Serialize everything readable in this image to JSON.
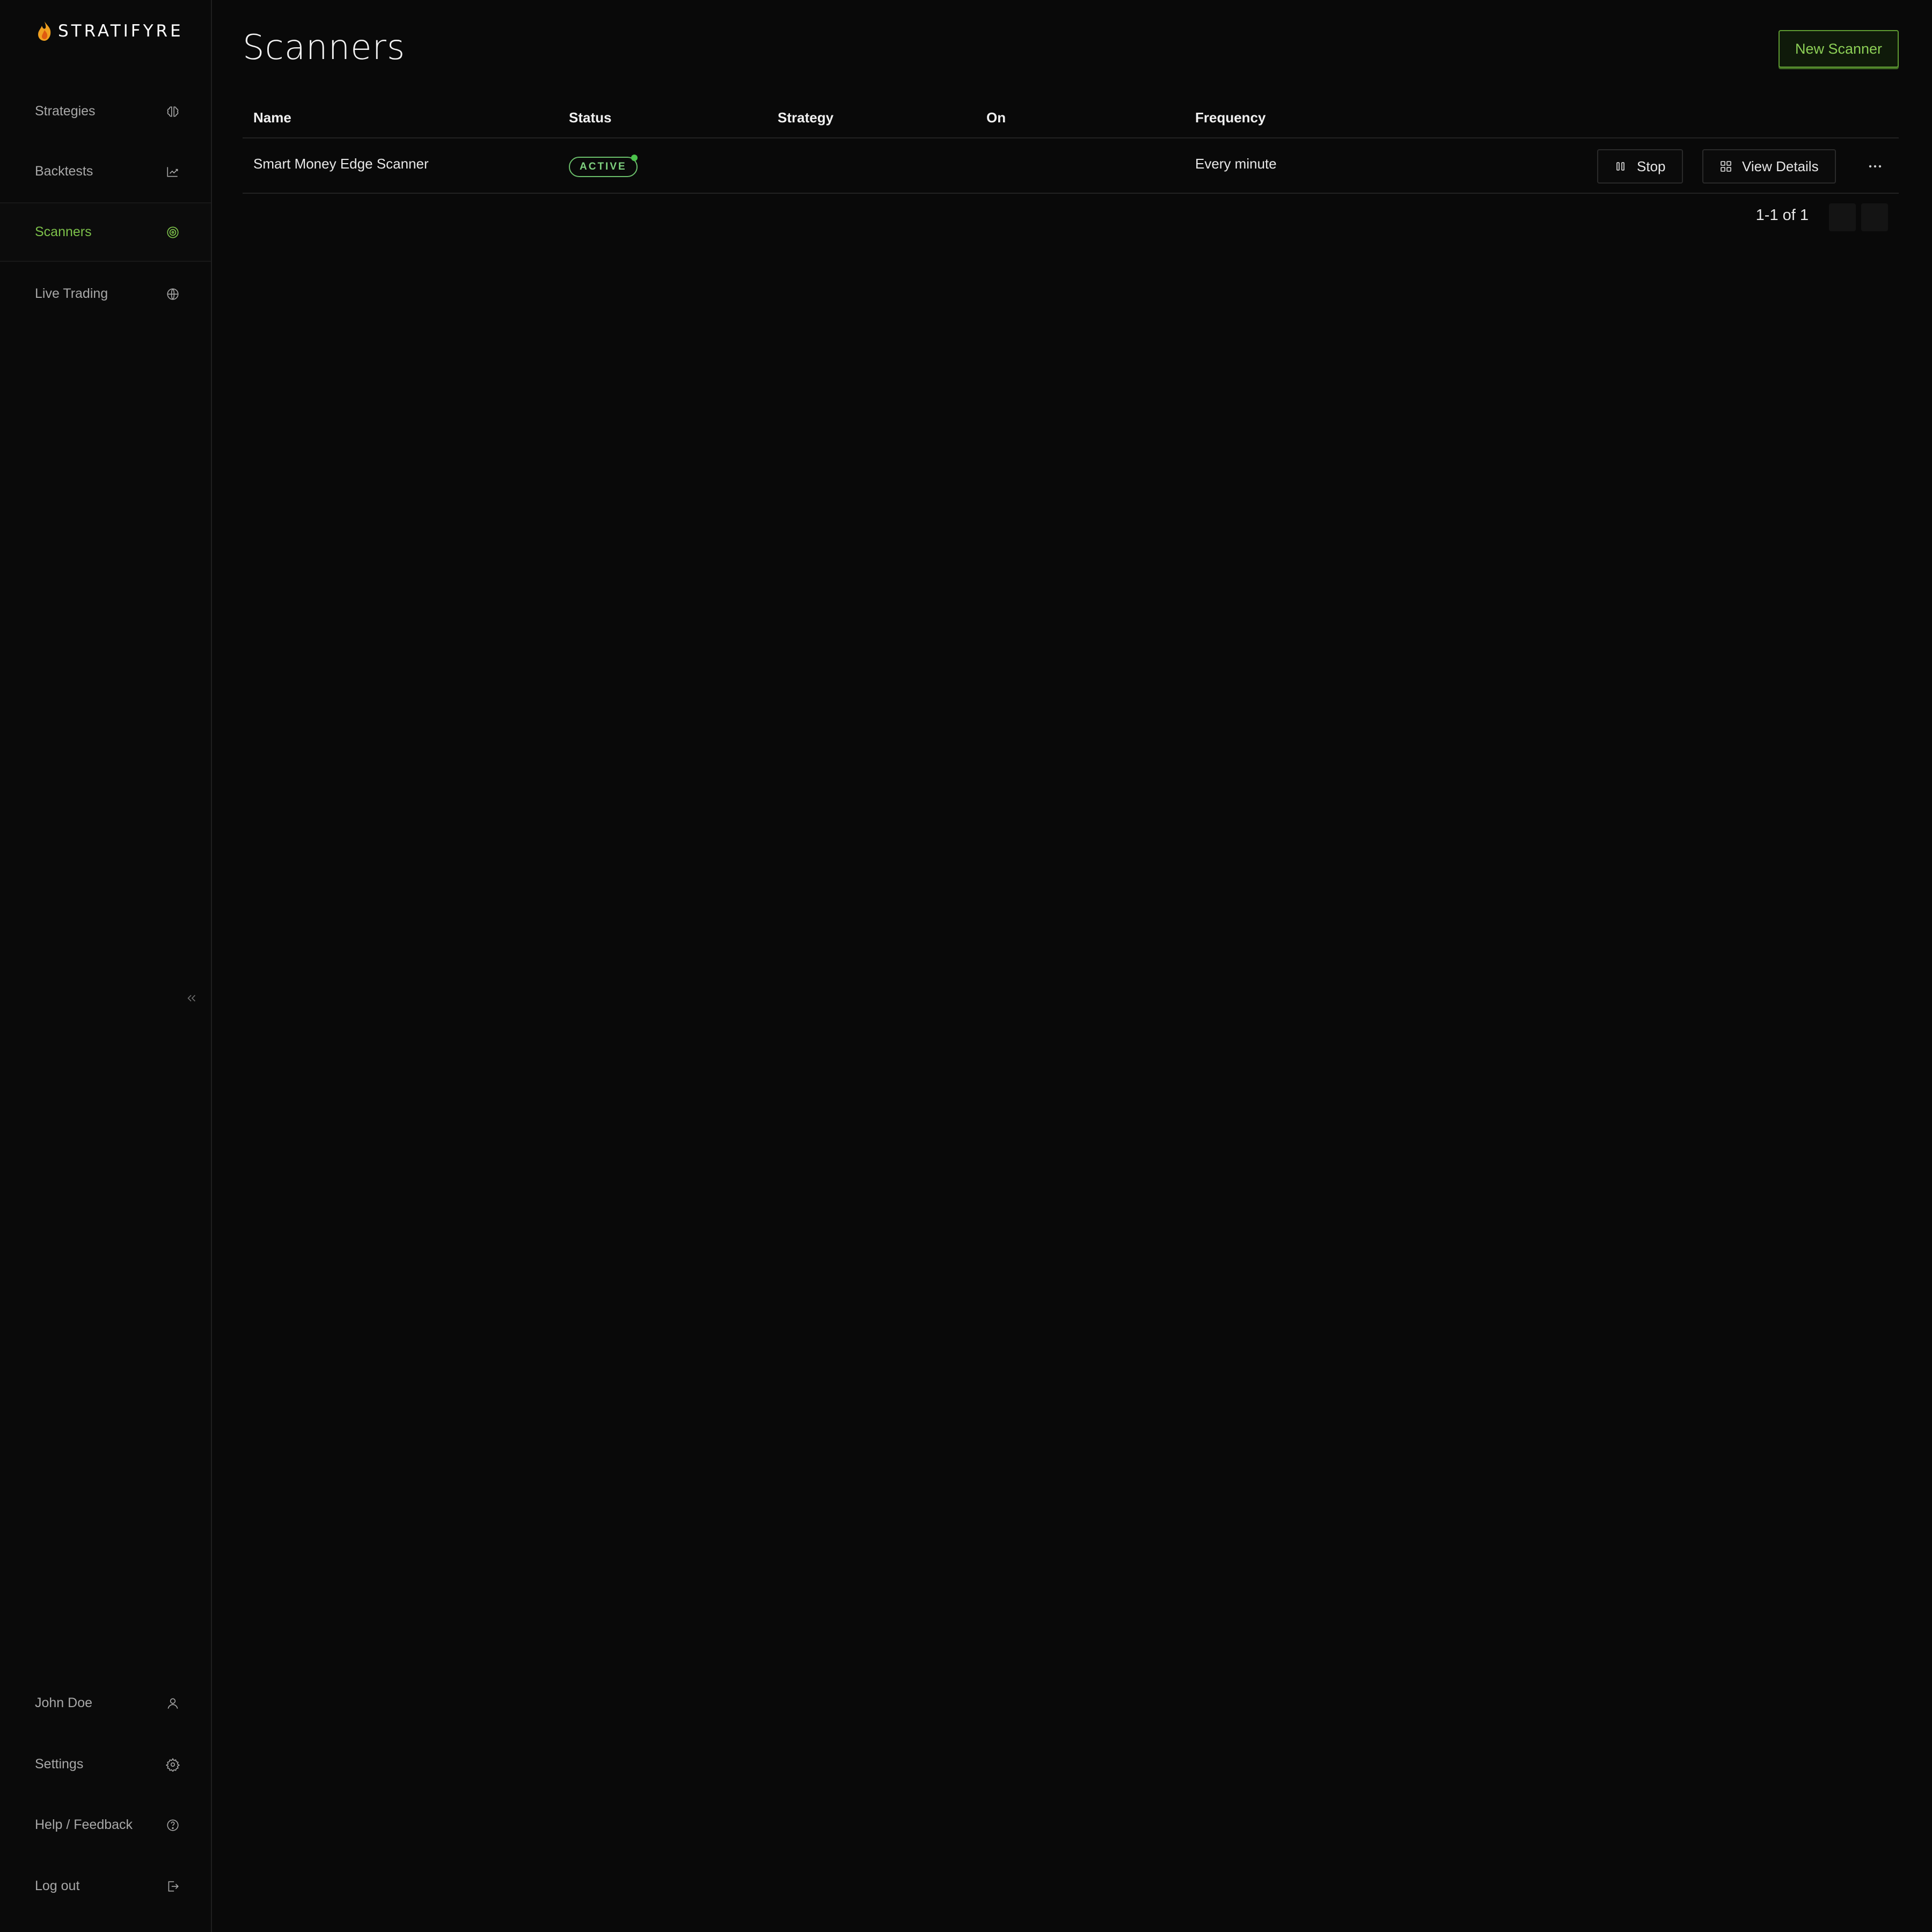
{
  "app": {
    "brand": "STRATIFYRE"
  },
  "sidebar": {
    "items": [
      {
        "label": "Strategies",
        "icon": "brain-icon"
      },
      {
        "label": "Backtests",
        "icon": "chart-icon"
      },
      {
        "label": "Scanners",
        "icon": "radar-icon",
        "active": true
      },
      {
        "label": "Live Trading",
        "icon": "globe-icon"
      }
    ],
    "bottom_items": [
      {
        "label": "John Doe",
        "icon": "user-icon"
      },
      {
        "label": "Settings",
        "icon": "gear-icon"
      },
      {
        "label": "Help / Feedback",
        "icon": "help-icon"
      },
      {
        "label": "Log out",
        "icon": "logout-icon"
      }
    ]
  },
  "header": {
    "title": "Scanners",
    "new_button_label": "New Scanner"
  },
  "table": {
    "columns": [
      "Name",
      "Status",
      "Strategy",
      "On",
      "Frequency"
    ],
    "rows": [
      {
        "name": "Smart Money Edge Scanner",
        "status": "ACTIVE",
        "strategy": "",
        "on": "",
        "frequency": "Every minute",
        "stop_label": "Stop",
        "details_label": "View Details"
      }
    ]
  },
  "pagination": {
    "text": "1-1 of 1"
  },
  "colors": {
    "accent": "#7cc04a",
    "background": "#090909",
    "status_active": "#6bbf6b"
  }
}
